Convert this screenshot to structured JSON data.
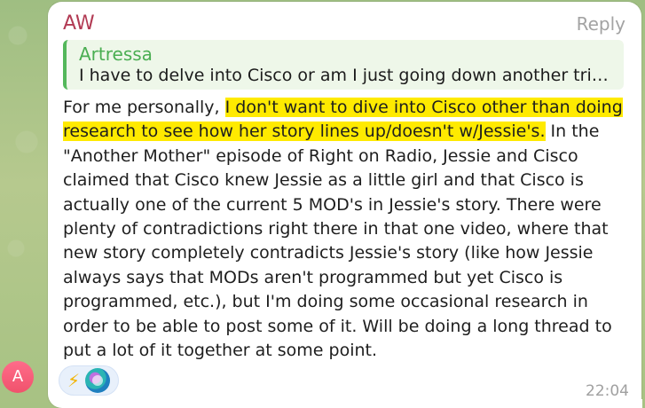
{
  "message": {
    "sender": "AW",
    "reply_label": "Reply",
    "quote": {
      "author": "Artressa",
      "text": "I have to delve into Cisco or am I just going down another trick..."
    },
    "body_intro": "For me personally, ",
    "body_highlight": "I don't want to dive into Cisco other than doing research to see how her story lines up/doesn't w/Jessie's.",
    "body_rest": "  In the \"Another Mother\" episode of Right on Radio, Jessie and Cisco claimed that Cisco knew Jessie as a little girl and that Cisco is actually one of the current 5 MOD's in Jessie's story.  There were plenty of contradictions right there in that one video, where that new story completely contradicts Jessie's story (like how Jessie always says that MODs aren't programmed but yet Cisco is programmed, etc.), but I'm doing some occasional research in order to be able to post some of it.  Will be doing a long thread to put a lot of it together at some point.",
    "time": "22:04",
    "reaction_emoji": "⚡"
  },
  "user_avatar": {
    "initial": "A"
  },
  "colors": {
    "sender": "#b23b54",
    "quote_author": "#4aae52",
    "highlight": "#ffea00",
    "avatar": "#f0526c"
  }
}
